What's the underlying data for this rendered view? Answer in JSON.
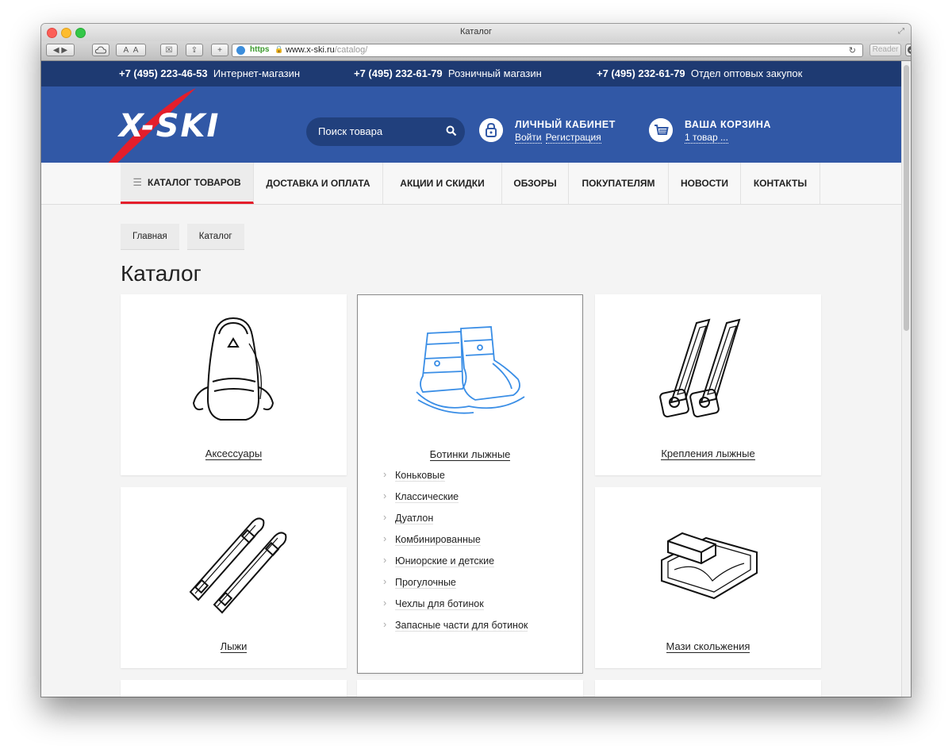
{
  "browser": {
    "window_title": "Каталог",
    "url_scheme": "https",
    "url_host": "www.x-ski.ru",
    "url_path": "/catalog/",
    "reader_label": "Reader"
  },
  "topbar": {
    "phones": [
      {
        "number": "+7 (495) 223-46-53",
        "label": "Интернет-магазин"
      },
      {
        "number": "+7 (495) 232-61-79",
        "label": "Розничный магазин"
      },
      {
        "number": "+7 (495) 232-61-79",
        "label": "Отдел оптовых закупок"
      }
    ]
  },
  "header": {
    "logo_text": "X-SKI",
    "search_placeholder": "Поиск товара",
    "account": {
      "title": "ЛИЧНЫЙ КАБИНЕТ",
      "login": "Войти",
      "register": "Регистрация"
    },
    "cart": {
      "title": "ВАША КОРЗИНА",
      "summary": "1 товар ..."
    }
  },
  "nav": {
    "items": [
      "КАТАЛОГ ТОВАРОВ",
      "ДОСТАВКА И ОПЛАТА",
      "АКЦИИ И СКИДКИ",
      "ОБЗОРЫ",
      "ПОКУПАТЕЛЯМ",
      "НОВОСТИ",
      "КОНТАКТЫ"
    ]
  },
  "breadcrumbs": [
    "Главная",
    "Каталог"
  ],
  "page_title": "Каталог",
  "catalog": {
    "accessories": "Аксессуары",
    "boots": "Ботинки лыжные",
    "bindings": "Крепления лыжные",
    "skis": "Лыжи",
    "wax": "Мази скольжения",
    "boots_sub": [
      "Коньковые",
      "Классические",
      "Дуатлон",
      "Комбинированные",
      "Юниорские и детские",
      "Прогулочные",
      "Чехлы для ботинок",
      "Запасные части для ботинок"
    ]
  },
  "colors": {
    "topbar": "#1e3a72",
    "header": "#3158a6",
    "accent": "#e41e2b",
    "boot_icon": "#3a8ee6"
  }
}
